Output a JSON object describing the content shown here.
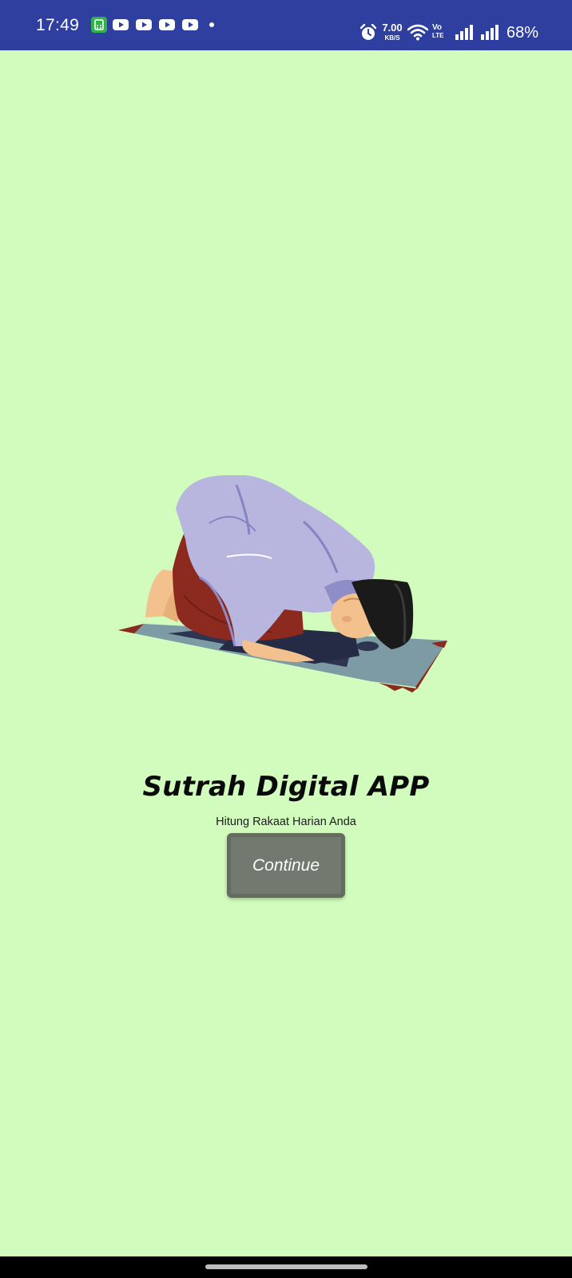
{
  "status_bar": {
    "time": "17:49",
    "network_speed": "7.00",
    "network_speed_unit": "KB/S",
    "volte_label": "Vo\nLTE",
    "battery": "68%",
    "notification_icons": [
      "app-notification-icon",
      "youtube-icon",
      "youtube-icon",
      "youtube-icon",
      "youtube-icon",
      "more-notifications-dot"
    ],
    "colors": {
      "background": "#2f3f9f",
      "foreground": "#ffffff"
    }
  },
  "main": {
    "illustration": "man-praying-sujud-on-prayer-mat",
    "title": "Sutrah Digital APP",
    "subtitle": "Hitung Rakaat Harian Anda",
    "continue_label": "Continue",
    "colors": {
      "background": "#d1fcbd",
      "button": "#72796f",
      "title": "#0a0a0a"
    }
  },
  "nav_bar": {
    "colors": {
      "background": "#000000",
      "indicator": "#bdbdbd"
    }
  }
}
